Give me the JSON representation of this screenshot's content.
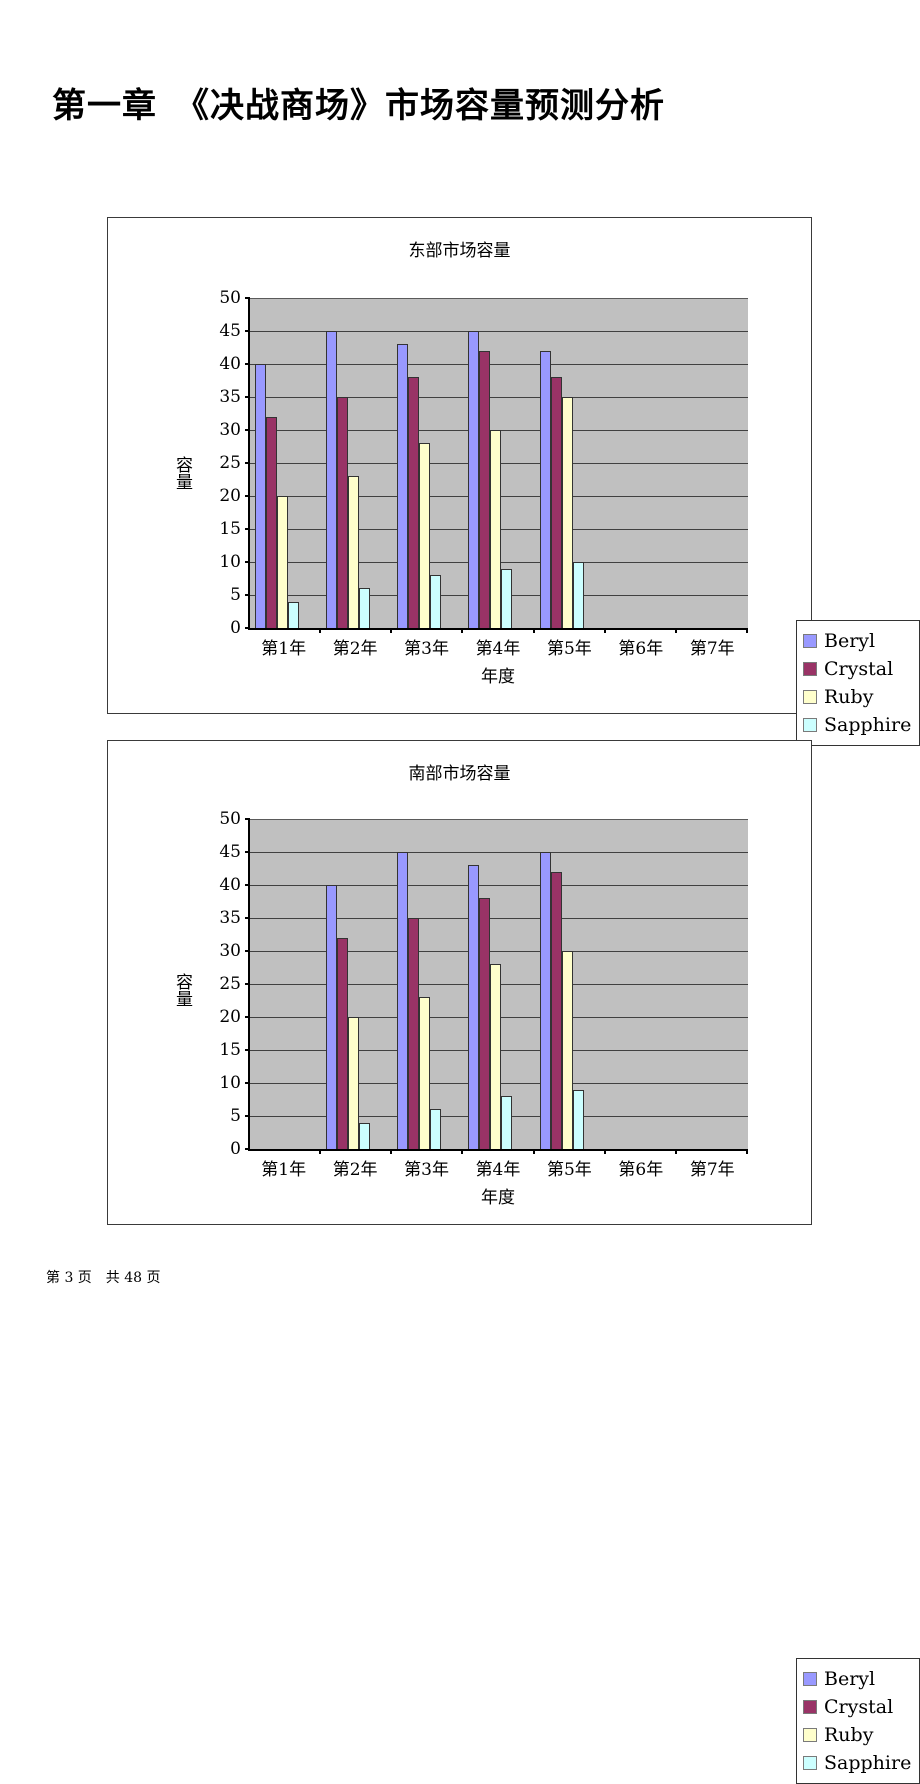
{
  "document": {
    "title": "第一章　《决战商场》市场容量预测分析",
    "footer": "第 3 页　共 48 页"
  },
  "palette": {
    "beryl": "#9999FF",
    "crystal": "#993366",
    "ruby": "#FFFFCC",
    "sapphire": "#CCFFFF",
    "plot_background": "#C0C0C0",
    "gridline": "#404040",
    "frame_border": "#3A3A3A"
  },
  "legend": {
    "entries": [
      {
        "label": "Beryl",
        "color": "#9999FF"
      },
      {
        "label": "Crystal",
        "color": "#993366"
      },
      {
        "label": "Ruby",
        "color": "#FFFFCC"
      },
      {
        "label": "Sapphire",
        "color": "#CCFFFF"
      }
    ]
  },
  "chart_data": [
    {
      "id": "east",
      "type": "bar",
      "title": "东部市场容量",
      "xlabel": "年度",
      "ylabel": "容量",
      "ylim": [
        0,
        50
      ],
      "yticks": [
        0,
        5,
        10,
        15,
        20,
        25,
        30,
        35,
        40,
        45,
        50
      ],
      "grid": true,
      "legend_position": "right",
      "categories": [
        "第1年",
        "第2年",
        "第3年",
        "第4年",
        "第5年",
        "第6年",
        "第7年"
      ],
      "series": [
        {
          "name": "Beryl",
          "color": "#9999FF",
          "values": [
            40,
            45,
            43,
            45,
            42,
            null,
            null
          ]
        },
        {
          "name": "Crystal",
          "color": "#993366",
          "values": [
            32,
            35,
            38,
            42,
            38,
            null,
            null
          ]
        },
        {
          "name": "Ruby",
          "color": "#FFFFCC",
          "values": [
            20,
            23,
            28,
            30,
            35,
            null,
            null
          ]
        },
        {
          "name": "Sapphire",
          "color": "#CCFFFF",
          "values": [
            4,
            6,
            8,
            9,
            10,
            null,
            null
          ]
        }
      ]
    },
    {
      "id": "south",
      "type": "bar",
      "title": "南部市场容量",
      "xlabel": "年度",
      "ylabel": "容量",
      "ylim": [
        0,
        50
      ],
      "yticks": [
        0,
        5,
        10,
        15,
        20,
        25,
        30,
        35,
        40,
        45,
        50
      ],
      "grid": true,
      "legend_position": "right",
      "categories": [
        "第1年",
        "第2年",
        "第3年",
        "第4年",
        "第5年",
        "第6年",
        "第7年"
      ],
      "series": [
        {
          "name": "Beryl",
          "color": "#9999FF",
          "values": [
            null,
            40,
            45,
            43,
            45,
            null,
            null
          ]
        },
        {
          "name": "Crystal",
          "color": "#993366",
          "values": [
            null,
            32,
            35,
            38,
            42,
            null,
            null
          ]
        },
        {
          "name": "Ruby",
          "color": "#FFFFCC",
          "values": [
            null,
            20,
            23,
            28,
            30,
            null,
            null
          ]
        },
        {
          "name": "Sapphire",
          "color": "#CCFFFF",
          "values": [
            null,
            4,
            6,
            8,
            9,
            null,
            null
          ]
        }
      ]
    }
  ]
}
